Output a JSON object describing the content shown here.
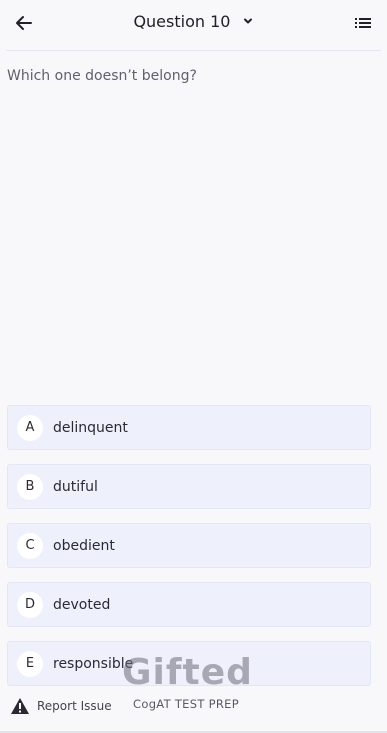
{
  "header": {
    "title": "Question 10"
  },
  "question": {
    "prompt": "Which one doesn’t belong?"
  },
  "options": [
    {
      "letter": "A",
      "text": "delinquent"
    },
    {
      "letter": "B",
      "text": "dutiful"
    },
    {
      "letter": "C",
      "text": "obedient"
    },
    {
      "letter": "D",
      "text": "devoted"
    },
    {
      "letter": "E",
      "text": "responsible"
    }
  ],
  "footer": {
    "report_label": "Report Issue"
  },
  "watermark": {
    "brand": "Gifted",
    "tagline": "CogAT TEST PREP"
  },
  "colors": {
    "background": "#f8f8fb",
    "option_bg": "#eef0fb",
    "text": "#2a2a33"
  },
  "icons": {
    "back": "arrow-left-icon",
    "title_dropdown": "chevron-down-icon",
    "menu": "list-icon",
    "report": "warning-icon"
  }
}
